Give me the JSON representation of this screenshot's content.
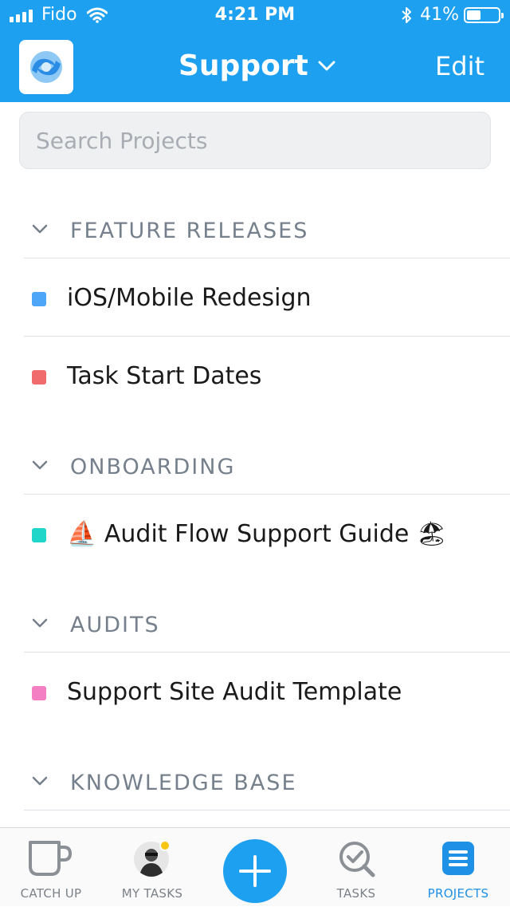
{
  "status_bar": {
    "carrier": "Fido",
    "time": "4:21 PM",
    "battery": "41%",
    "battery_level": 0.41
  },
  "header": {
    "title": "Support",
    "edit_label": "Edit"
  },
  "search": {
    "placeholder": "Search Projects",
    "value": ""
  },
  "sections": [
    {
      "title": "FEATURE RELEASES",
      "items": [
        {
          "name": "iOS/Mobile Redesign",
          "color": "#4da6f7"
        },
        {
          "name": "Task Start Dates",
          "color": "#f06c6c"
        }
      ]
    },
    {
      "title": "ONBOARDING",
      "items": [
        {
          "name": "⛵ Audit Flow Support Guide 🏖",
          "color": "#1fd6c8"
        }
      ]
    },
    {
      "title": "AUDITS",
      "items": [
        {
          "name": "Support Site Audit Template",
          "color": "#f57fc3"
        }
      ]
    },
    {
      "title": "KNOWLEDGE BASE",
      "items": []
    }
  ],
  "tabbar": {
    "tabs": [
      {
        "label": "CATCH UP",
        "icon": "coffee-cup-icon"
      },
      {
        "label": "MY TASKS",
        "icon": "avatar-icon"
      },
      {
        "label": "",
        "icon": "plus-icon"
      },
      {
        "label": "TASKS",
        "icon": "search-check-icon"
      },
      {
        "label": "PROJECTS",
        "icon": "projects-list-icon",
        "active": true
      }
    ]
  },
  "colors": {
    "brand_blue": "#1ea0f0",
    "active_tab": "#1e90e6",
    "notification_dot": "#f7c513"
  }
}
